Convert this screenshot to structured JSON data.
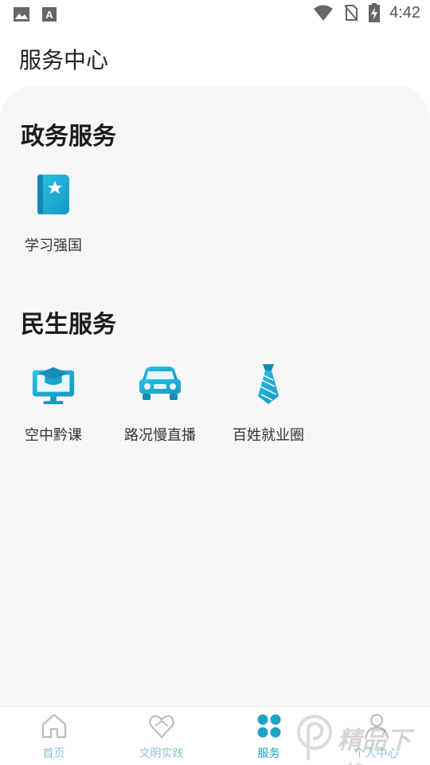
{
  "status_bar": {
    "time": "4:42",
    "icons": [
      "image-icon",
      "a-icon",
      "wifi-icon",
      "no-sim-icon",
      "battery-charging-icon"
    ]
  },
  "page": {
    "title": "服务中心"
  },
  "sections": [
    {
      "title": "政务服务",
      "items": [
        {
          "label": "学习强国",
          "icon": "book-star-icon"
        }
      ]
    },
    {
      "title": "民生服务",
      "items": [
        {
          "label": "空中黔课",
          "icon": "graduation-monitor-icon"
        },
        {
          "label": "路况慢直播",
          "icon": "car-icon"
        },
        {
          "label": "百姓就业圈",
          "icon": "tie-icon"
        }
      ]
    }
  ],
  "tabbar": {
    "tabs": [
      {
        "label": "首页",
        "icon": "home-icon",
        "active": false
      },
      {
        "label": "文明实践",
        "icon": "heart-hands-icon",
        "active": false
      },
      {
        "label": "服务",
        "icon": "grid-dots-icon",
        "active": true
      },
      {
        "label": "个人中心",
        "icon": "person-icon",
        "active": false
      }
    ]
  },
  "watermark": {
    "text": "精品下载"
  },
  "colors": {
    "accent": "#1aa4c8",
    "tab_inactive": "#8bc3d6",
    "card_bg": "#f7f7f7"
  }
}
